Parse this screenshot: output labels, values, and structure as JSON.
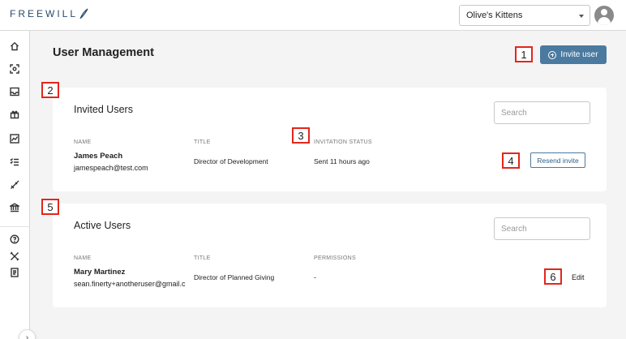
{
  "header": {
    "logo_text": "FREEWILL",
    "organization": "Olive's Kittens"
  },
  "page": {
    "title": "User Management",
    "invite_button": "Invite user"
  },
  "invited_users": {
    "title": "Invited Users",
    "search_placeholder": "Search",
    "columns": {
      "name": "NAME",
      "title": "TITLE",
      "status": "INVITATION STATUS"
    },
    "rows": [
      {
        "name": "James Peach",
        "email": "jamespeach@test.com",
        "title": "Director of Development",
        "status": "Sent 11 hours ago",
        "action": "Resend invite"
      }
    ]
  },
  "active_users": {
    "title": "Active Users",
    "search_placeholder": "Search",
    "columns": {
      "name": "NAME",
      "title": "TITLE",
      "permissions": "PERMISSIONS"
    },
    "rows": [
      {
        "name": "Mary Martinez",
        "email": "sean.finerty+anotheruser@gmail.c",
        "title": "Director of Planned Giving",
        "permissions": "-",
        "action": "Edit"
      }
    ]
  },
  "sidebar": {
    "icons": [
      "home-icon",
      "scan-icon",
      "inbox-icon",
      "gift-icon",
      "chart-icon",
      "checklist-icon",
      "rocket-icon",
      "bank-icon",
      "help-icon",
      "tools-icon",
      "document-icon"
    ],
    "collapse_glyph": "›"
  },
  "markers": [
    "1",
    "2",
    "3",
    "4",
    "5",
    "6"
  ],
  "colors": {
    "primary": "#4b7aa0",
    "marker": "#e3261c",
    "background": "#f4f4f4"
  }
}
